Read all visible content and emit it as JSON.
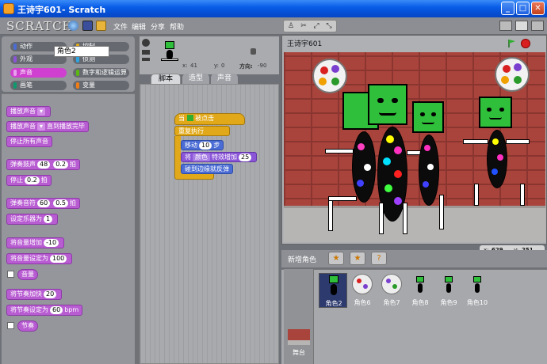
{
  "window": {
    "title": "王诗宇601- Scratch"
  },
  "topbar": {
    "logo": "SCRATCH",
    "menus": [
      "文件",
      "编辑",
      "分享",
      "帮助"
    ]
  },
  "categories": [
    {
      "label": "动作",
      "color": "#4a6cd4"
    },
    {
      "label": "控制",
      "color": "#e1a91a"
    },
    {
      "label": "外观",
      "color": "#8a55d7"
    },
    {
      "label": "侦测",
      "color": "#2ca5e2"
    },
    {
      "label": "声音",
      "color": "#bb42c3",
      "active": true
    },
    {
      "label": "数字和逻辑运算",
      "color": "#5cb712"
    },
    {
      "label": "画笔",
      "color": "#0e9a6c"
    },
    {
      "label": "变量",
      "color": "#ee7d16"
    }
  ],
  "palette": {
    "play_sound": "播放声音",
    "play_sound_until_done": "播放声音",
    "play_sound_until_done_suffix": "直到播放完毕",
    "stop_all_sounds": "停止所有声音",
    "play_drum": "弹奏鼓声",
    "drum_value": "48",
    "drum_beats": "0.2",
    "beats_suffix": "拍",
    "rest": "停止",
    "rest_beats": "0.2",
    "play_note": "弹奏音符",
    "note_value": "60",
    "note_beats": "0.5",
    "set_instrument": "设定乐器为",
    "instrument_value": "1",
    "change_volume": "将音量增加",
    "volume_change_value": "-10",
    "set_volume": "将音量设定为",
    "volume_value": "100",
    "volume_reporter": "音量",
    "change_tempo": "将节奏加快",
    "tempo_change_value": "20",
    "set_tempo": "将节奏设定为",
    "tempo_value": "60",
    "tempo_unit": "bpm",
    "tempo_reporter": "节奏"
  },
  "sprite_info": {
    "name": "角色2",
    "x_label": "x:",
    "x_value": "41",
    "y_label": "y:",
    "y_value": "0",
    "direction_label": "方向:",
    "direction_value": "-90"
  },
  "tabs": [
    "脚本",
    "造型",
    "声音"
  ],
  "script": {
    "hat": "当",
    "hat_suffix": "被点击",
    "forever": "重复执行",
    "move": "移动",
    "move_steps": "10",
    "move_suffix": "步",
    "effect_prefix": "将",
    "effect_name": "颜色",
    "effect_mid": "特效增加",
    "effect_value": "25",
    "bounce": "碰到边缘就反弹"
  },
  "stage": {
    "title": "王诗宇601",
    "mouse_x_label": "x:",
    "mouse_x": "629",
    "mouse_y_label": "y:",
    "mouse_y": "251"
  },
  "sprite_list": {
    "new_sprite_label": "新增角色",
    "stage_label": "舞台",
    "sprites": [
      "角色2",
      "角色6",
      "角色7",
      "角色8",
      "角色9",
      "角色10"
    ]
  }
}
